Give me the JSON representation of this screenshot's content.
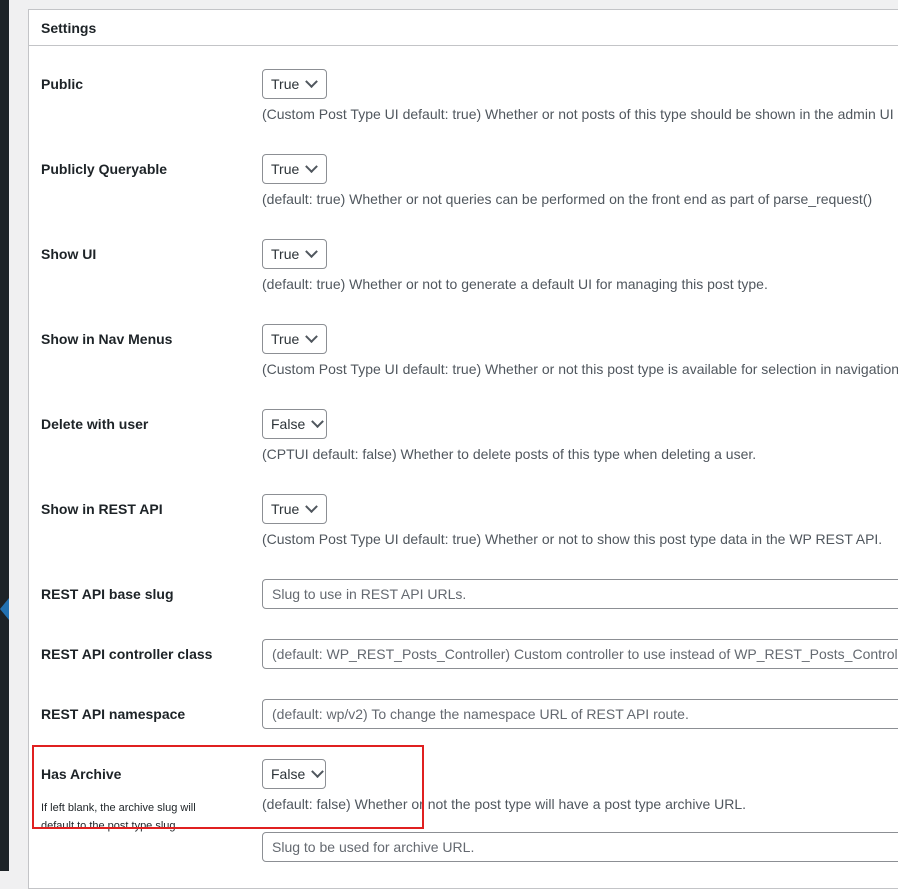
{
  "panel": {
    "title": "Settings"
  },
  "rows": [
    {
      "label": "Public",
      "value": "True",
      "desc": "(Custom Post Type UI default: true) Whether or not posts of this type should be shown in the admin UI a"
    },
    {
      "label": "Publicly Queryable",
      "value": "True",
      "desc": "(default: true) Whether or not queries can be performed on the front end as part of parse_request()"
    },
    {
      "label": "Show UI",
      "value": "True",
      "desc": "(default: true) Whether or not to generate a default UI for managing this post type."
    },
    {
      "label": "Show in Nav Menus",
      "value": "True",
      "desc": "(Custom Post Type UI default: true) Whether or not this post type is available for selection in navigation"
    },
    {
      "label": "Delete with user",
      "value": "False",
      "desc": "(CPTUI default: false) Whether to delete posts of this type when deleting a user."
    },
    {
      "label": "Show in REST API",
      "value": "True",
      "desc": "(Custom Post Type UI default: true) Whether or not to show this post type data in the WP REST API."
    }
  ],
  "inputs": [
    {
      "label": "REST API base slug",
      "placeholder": "Slug to use in REST API URLs."
    },
    {
      "label": "REST API controller class",
      "placeholder": "(default: WP_REST_Posts_Controller) Custom controller to use instead of WP_REST_Posts_Controller."
    },
    {
      "label": "REST API namespace",
      "placeholder": "(default: wp/v2) To change the namespace URL of REST API route."
    }
  ],
  "archive": {
    "label": "Has Archive",
    "value": "False",
    "note": "If left blank, the archive slug will default to the post type slug.",
    "desc": "(default: false) Whether or not the post type will have a post type archive URL.",
    "slug_placeholder": "Slug to be used for archive URL."
  },
  "colors": {
    "highlight": "#e02020",
    "accent": "#2271b1"
  }
}
